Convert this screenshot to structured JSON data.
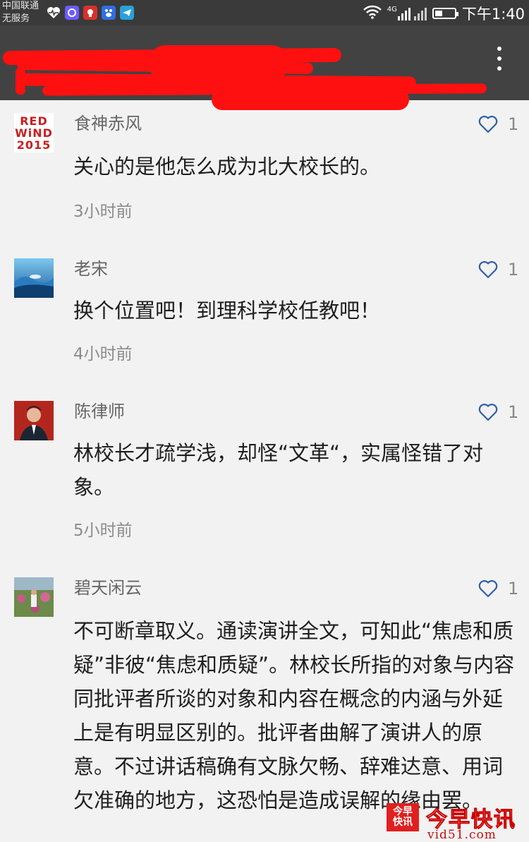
{
  "status_bar": {
    "carrier_line1": "中国联通",
    "carrier_line2": "无服务",
    "network": "4G",
    "time": "下午1:40",
    "icons": [
      "heartbeat-icon",
      "message-app-icon",
      "red-app-icon",
      "paw-app-icon",
      "telegram-icon",
      "wifi-icon",
      "signal-icon",
      "battery-icon"
    ]
  },
  "header": {
    "title_redacted": true,
    "menu_icon": "more-vert-icon"
  },
  "colors": {
    "status_bg": "#3a3a3a",
    "header_bg": "#424242",
    "page_bg": "#f2f2f2",
    "redaction": "#ff1010"
  },
  "comments": [
    {
      "author": "食神赤风",
      "avatar_text": [
        "RED",
        "WiND",
        "2015"
      ],
      "likes": "1",
      "text": "关心的是他怎么成为北大校长的。",
      "time": "3小时前"
    },
    {
      "author": "老宋",
      "likes": "1",
      "text": "换个位置吧！到理科学校任教吧！",
      "time": "4小时前"
    },
    {
      "author": "陈律师",
      "likes": "1",
      "text": "林校长才疏学浅，却怪“文革“，实属怪错了对象。",
      "time": "5小时前"
    },
    {
      "author": "碧天闲云",
      "likes": "1",
      "text": "不可断章取义。通读演讲全文，可知此“焦虑和质疑”非彼“焦虑和质疑”。林校长所指的对象与内容同批评者所谈的对象和内容在概念的内涵与外延上是有明显区别的。批评者曲解了演讲人的原意。不过讲话稿确有文脉欠畅、辞难达意、用词欠准确的地方，这恐怕是造成误解的缘由罢。"
    }
  ],
  "watermark": {
    "logo_text": "今早快讯",
    "name": "今早快讯",
    "url": "vid51.com"
  }
}
